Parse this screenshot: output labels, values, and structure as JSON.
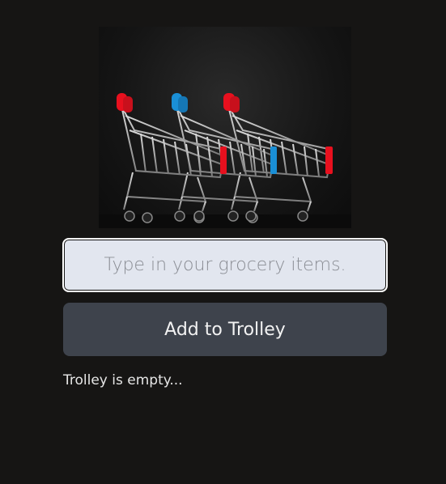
{
  "hero": {
    "image_icon": "shopping-trolleys-icon",
    "handle_colors": [
      "#e8101e",
      "#1a8fd6",
      "#e8101e"
    ]
  },
  "form": {
    "input_value": "",
    "input_placeholder": "Type in your grocery items.",
    "add_button_label": "Add to Trolley"
  },
  "trolley": {
    "status_text": "Trolley is empty..."
  },
  "colors": {
    "background": "#161514",
    "input_background": "#e2e6ef",
    "button_background": "#3e434c"
  }
}
